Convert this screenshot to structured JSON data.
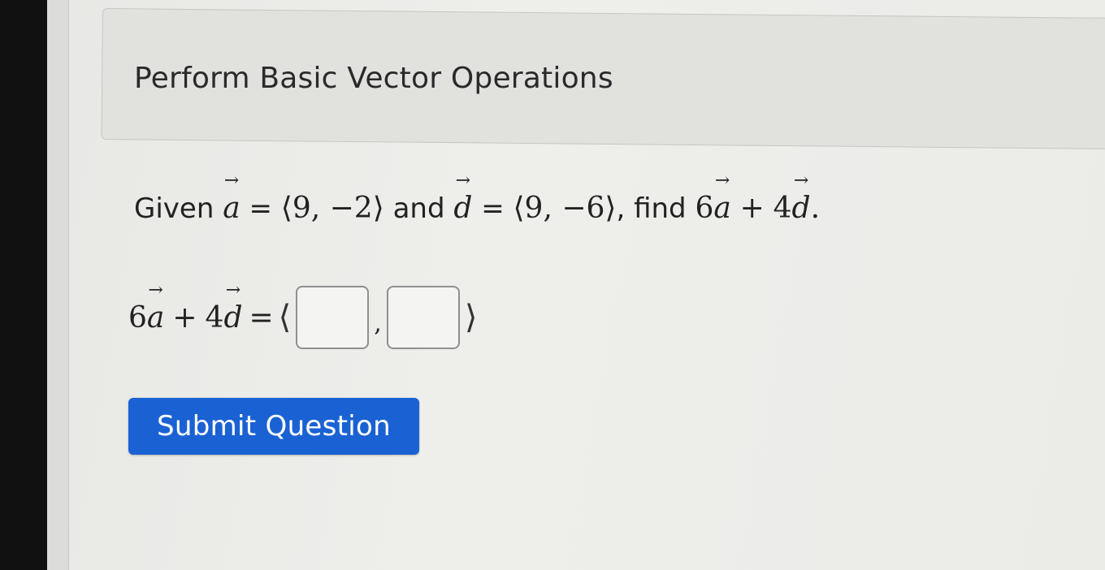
{
  "header": {
    "title": "Perform Basic Vector Operations"
  },
  "question": {
    "given": "Given",
    "vec_a_letter": "a",
    "equals": "=",
    "vec_a_value": "⟨9, −2⟩",
    "and": "and",
    "vec_d_letter": "d",
    "vec_d_value": "⟨9, −6⟩",
    "find_prefix": ", find",
    "coef_a": "6",
    "plus": "+",
    "coef_d": "4",
    "period": "."
  },
  "answer": {
    "coef_a": "6",
    "vec_a_letter": "a",
    "plus": "+",
    "coef_d": "4",
    "vec_d_letter": "d",
    "equals": "=",
    "open_bracket": "⟨",
    "separator": ",",
    "close_bracket": "⟩",
    "x_value": "",
    "y_value": ""
  },
  "submit": {
    "label": "Submit Question"
  },
  "colors": {
    "submit_button": "#1a62d4",
    "background": "#e7e6e2",
    "header_box": "#e1e1de"
  }
}
